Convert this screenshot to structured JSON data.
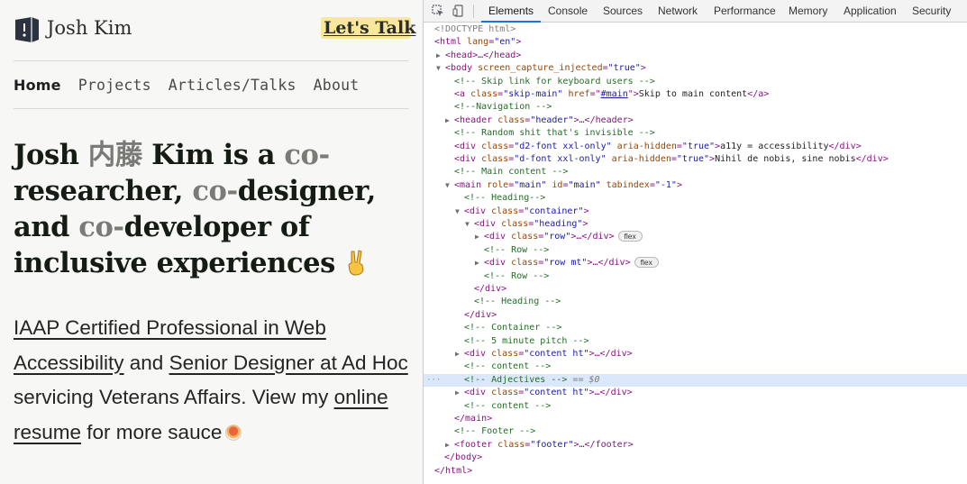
{
  "site": {
    "name": "Josh Kim",
    "cta": "Let's Talk",
    "nav": [
      "Home",
      "Projects",
      "Articles/Talks",
      "About"
    ],
    "headline": {
      "line1a": "Josh ",
      "kanji": "内藤",
      "line1b": " Kim is a ",
      "co1": "co-",
      "line2a": "researcher, ",
      "co2": "co-",
      "line2b": "designer,",
      "line3a": "and ",
      "co3": "co-",
      "line3b": "developer of",
      "line4": "inclusive experiences"
    },
    "intro": {
      "link1": "IAAP Certified Professional in Web Accessibility",
      "t1": " and ",
      "link2": "Senior Designer at Ad Hoc",
      "t2": " servicing Veterans Affairs. View my ",
      "link3": "online resume",
      "t3": " for more sauce"
    }
  },
  "devtools": {
    "tabs": [
      "Elements",
      "Console",
      "Sources",
      "Network",
      "Performance",
      "Memory",
      "Application",
      "Security"
    ],
    "active_tab": "Elements",
    "badge": "flex",
    "selected_marker": "== $0",
    "dom": {
      "doctype": "<!DOCTYPE html>",
      "html_open": "<html ",
      "lang_attr": "lang",
      "lang_val": "\"en\"",
      "head": "<head>…</head>",
      "body_open": "<body ",
      "body_attr": "screen_capture_injected",
      "body_val": "\"true\"",
      "c_skip": "<!-- Skip link for keyboard users -->",
      "a_open": "<a ",
      "a_class": "class",
      "a_class_val": "\"skip-main\"",
      "a_href": "href",
      "a_href_val": "#main",
      "a_text": "Skip to main content",
      "a_close": "</a>",
      "c_nav": "<!--Navigation -->",
      "header_line": "header",
      "header_class_val": "\"header\"",
      "header_close": "…</header>",
      "c_random": "<!-- Random shit that's invisible -->",
      "d2_class_val": "\"d2-font xxl-only\"",
      "aria": "aria-hidden",
      "aria_val": "\"true\"",
      "d2_text": "a11y = accessibility",
      "d_class_val": "\"d-font xxl-only\"",
      "d_text": "Nihil de nobis, sine nobis",
      "c_main": "<!-- Main content -->",
      "main_role": "role",
      "main_role_val": "\"main\"",
      "main_id": "id",
      "main_id_val": "\"main\"",
      "main_tab": "tabindex",
      "main_tab_val": "\"-1\"",
      "c_heading": "<!-- Heading-->",
      "container_val": "\"container\"",
      "heading_val": "\"heading\"",
      "row_val": "\"row\"",
      "c_row": "<!-- Row -->",
      "rowmt_val": "\"row mt\"",
      "c_heading_end": "<!-- Heading -->",
      "c_container": "<!-- Container -->",
      "c_pitch": "<!-- 5 minute pitch -->",
      "content_val": "\"content ht\"",
      "c_content": "<!-- content -->",
      "c_adjectives": "<!-- Adjectives -->",
      "c_footer": "<!-- Footer -->",
      "footer_val": "\"footer\""
    }
  }
}
